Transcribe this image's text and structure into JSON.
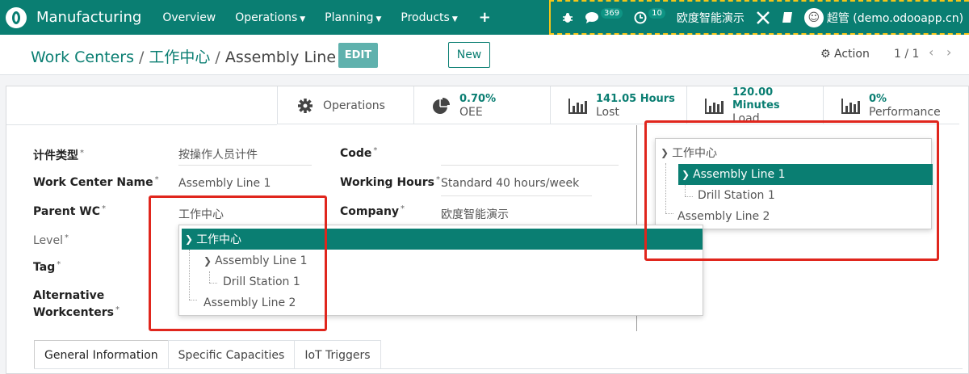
{
  "navbar": {
    "app_name": "Manufacturing",
    "menu": [
      "Overview",
      "Operations",
      "Planning",
      "Products"
    ],
    "add_label": "+",
    "messages_count": "369",
    "activities_count": "10",
    "company": "欧度智能演示",
    "user": "超管 (demo.odooapp.cn)"
  },
  "control": {
    "breadcrumb": [
      "Work Centers",
      "工作中心",
      "Assembly Line 1"
    ],
    "edit_label": "EDIT",
    "new_label": "New",
    "action_label": "Action",
    "pager": "1 / 1"
  },
  "smart_buttons": [
    {
      "value": "",
      "label": "Operations",
      "icon": "gear-icon"
    },
    {
      "value": "0.70%",
      "label": "OEE",
      "icon": "pie-chart-icon"
    },
    {
      "value": "141.05 Hours",
      "label": "Lost",
      "icon": "bar-chart-icon"
    },
    {
      "value": "120.00 Minutes",
      "label": "Load",
      "icon": "bar-chart-icon"
    },
    {
      "value": "0%",
      "label": "Performance",
      "icon": "bar-chart-icon"
    }
  ],
  "form": {
    "counting_type_label": "计件类型",
    "counting_type_value": "按操作人员计件",
    "name_label": "Work Center Name",
    "name_value": "Assembly Line 1",
    "parent_label": "Parent WC",
    "parent_value": "工作中心",
    "level_label": "Level",
    "tag_label": "Tag",
    "alt_label_1": "Alternative",
    "alt_label_2": "Workcenters",
    "code_label": "Code",
    "hours_label": "Working Hours",
    "hours_value": "Standard 40 hours/week",
    "company_label": "Company",
    "company_value": "欧度智能演示",
    "required_mark": "*"
  },
  "tree": {
    "root": "工作中心",
    "child": "Assembly Line 1",
    "grandchild": "Drill Station 1",
    "sibling": "Assembly Line 2"
  },
  "tabs": [
    "General Information",
    "Specific Capacities",
    "IoT Triggers"
  ],
  "colors": {
    "brand": "#0a7e72",
    "highlight": "#e0261d"
  }
}
